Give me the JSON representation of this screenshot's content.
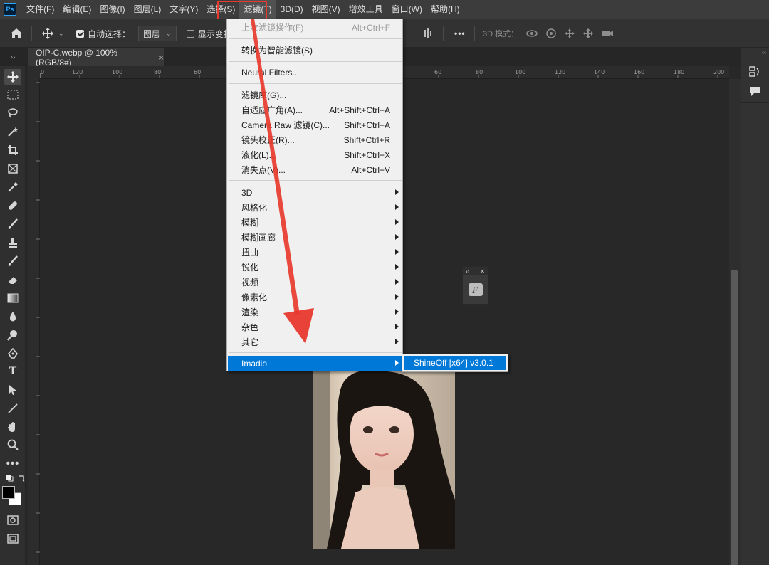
{
  "app": {
    "logo_text": "Ps"
  },
  "menubar": {
    "items": [
      "文件(F)",
      "编辑(E)",
      "图像(I)",
      "图层(L)",
      "文字(Y)",
      "选择(S)",
      "滤镜(T)",
      "3D(D)",
      "视图(V)",
      "增效工具",
      "窗口(W)",
      "帮助(H)"
    ],
    "active_index": 6
  },
  "options": {
    "auto_select_label": "自动选择：",
    "auto_select_checked": true,
    "auto_select_target": "图层",
    "show_transform_label": "显示变换控件",
    "more_label": "•••",
    "mode_3d_label": "3D 模式："
  },
  "document": {
    "tab_title": "OIP-C.webp @ 100%(RGB/8#)",
    "tab_close": "×"
  },
  "ruler": {
    "top_ticks": [
      "0",
      "120",
      "100",
      "80",
      "60",
      "60",
      "80",
      "100",
      "120",
      "140",
      "160",
      "180",
      "200"
    ]
  },
  "filter_menu": {
    "items": [
      {
        "label": "上次滤镜操作(F)",
        "shortcut": "Alt+Ctrl+F",
        "disabled": true
      },
      {
        "label": "转换为智能滤镜(S)"
      },
      {
        "label": "Neural Filters..."
      },
      {
        "label": "滤镜库(G)..."
      },
      {
        "label": "自适应广角(A)...",
        "shortcut": "Alt+Shift+Ctrl+A"
      },
      {
        "label": "Camera Raw 滤镜(C)...",
        "shortcut": "Shift+Ctrl+A"
      },
      {
        "label": "镜头校正(R)...",
        "shortcut": "Shift+Ctrl+R"
      },
      {
        "label": "液化(L)...",
        "shortcut": "Shift+Ctrl+X"
      },
      {
        "label": "消失点(V)...",
        "shortcut": "Alt+Ctrl+V"
      },
      {
        "label": "3D",
        "submenu": true
      },
      {
        "label": "风格化",
        "submenu": true
      },
      {
        "label": "模糊",
        "submenu": true
      },
      {
        "label": "模糊画廊",
        "submenu": true
      },
      {
        "label": "扭曲",
        "submenu": true
      },
      {
        "label": "锐化",
        "submenu": true
      },
      {
        "label": "视频",
        "submenu": true
      },
      {
        "label": "像素化",
        "submenu": true
      },
      {
        "label": "渲染",
        "submenu": true
      },
      {
        "label": "杂色",
        "submenu": true
      },
      {
        "label": "其它",
        "submenu": true
      },
      {
        "label": "Imadio",
        "submenu": true,
        "hover": true
      }
    ]
  },
  "submenu": {
    "item": "ShineOff [x64] v3.0.1"
  },
  "colors": {
    "highlight": "#0078d7",
    "annotation_red": "#e8392e",
    "app_bg": "#282828"
  },
  "icons": {
    "home": "home-icon",
    "move": "move-icon",
    "more": "more-icon"
  }
}
